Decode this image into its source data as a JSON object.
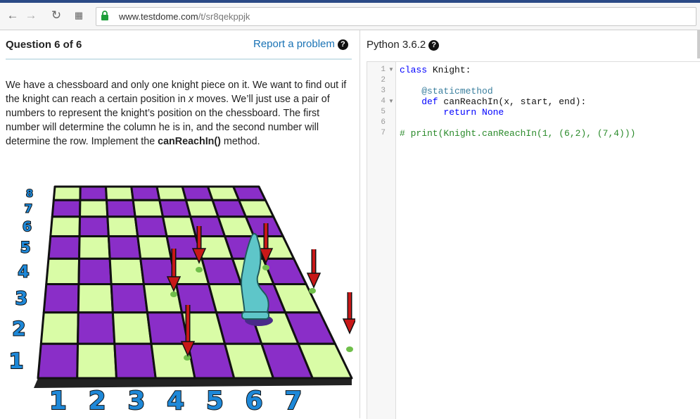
{
  "browser": {
    "url_domain": "www.testdome.com",
    "url_path": "/t/sr8qekppjk"
  },
  "question": {
    "title": "Question 6 of 6",
    "report_label": "Report a problem",
    "desc_part1": "We have a chessboard and only one knight piece on it. We want to find out if the knight can reach a certain position in ",
    "desc_x": "x",
    "desc_part2": " moves. We’ll just use a pair of numbers to represent the knight’s position on the chessboard. The first number will determine the column he is in, and the second number will determine the row. Implement the ",
    "desc_method": "canReachIn()",
    "desc_part3": " method."
  },
  "board": {
    "row_labels": [
      "1",
      "2",
      "3",
      "4",
      "5",
      "6",
      "7",
      "8"
    ],
    "col_labels": [
      "1",
      "2",
      "3",
      "4",
      "5",
      "6",
      "7"
    ],
    "colors": {
      "dark": "#8a2ec8",
      "light": "#d9fca6",
      "knight": "#5ec6c9",
      "arrow": "#c81818"
    }
  },
  "editor": {
    "language": "Python 3.6.2",
    "line_numbers": [
      "1",
      "2",
      "3",
      "4",
      "5",
      "6",
      "7"
    ],
    "lines": {
      "l1_kw": "class",
      "l1_rest": " Knight:",
      "l3": "    @staticmethod",
      "l4_kw": "    def",
      "l4_rest": " canReachIn(x, start, end):",
      "l5_kw": "        return",
      "l5_rest": " None",
      "l7": "# print(Knight.canReachIn(1, (6,2), (7,4)))"
    }
  }
}
